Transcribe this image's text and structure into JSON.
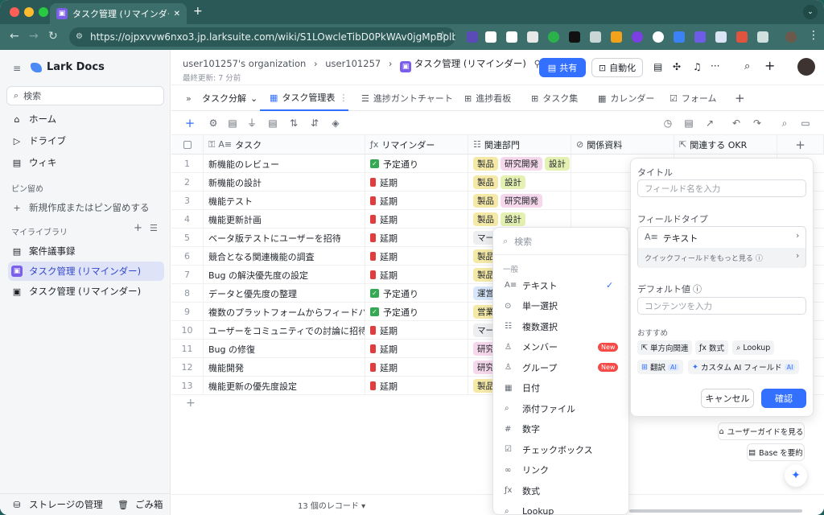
{
  "browser": {
    "tab_title": "タスク管理 (リマインダー) - Lar",
    "url": "https://ojpxvvw6nxo3.jp.larksuite.com/wiki/S1LOwcleTibD0PkWAv0jgMpBplb?table=tbl21..."
  },
  "sidebar": {
    "app_name": "Lark Docs",
    "search_label": "検索",
    "nav": [
      "ホーム",
      "ドライブ",
      "ウィキ"
    ],
    "pin_section": "ピン留め",
    "pin_new": "新規作成またはピン留めする",
    "library_section": "マイライブラリ",
    "library": [
      "案件議事録",
      "タスク管理 (リマインダー)",
      "タスク管理 (リマインダー)"
    ],
    "storage": "ストレージの管理",
    "trash": "ごみ箱"
  },
  "header": {
    "org": "user101257's organization",
    "user": "user101257",
    "title": "タスク管理 (リマインダー)",
    "updated": "最終更新: 7 分前",
    "share": "共有",
    "automation": "自動化"
  },
  "views": {
    "group": "タスク分解",
    "tabs": [
      "タスク管理表",
      "進捗ガントチャート",
      "進捗看板",
      "タスク集",
      "カレンダー",
      "フォーム"
    ]
  },
  "table": {
    "columns": [
      "タスク",
      "リマインダー",
      "関連部門",
      "関係資料",
      "関連する OKR"
    ],
    "rows": [
      {
        "n": "1",
        "task": "新機能のレビュー",
        "status": "予定通り",
        "ok": true,
        "depts": [
          "製品",
          "研究開発",
          "設計"
        ]
      },
      {
        "n": "2",
        "task": "新機能の設計",
        "status": "延期",
        "ok": false,
        "depts": [
          "製品",
          "設計"
        ]
      },
      {
        "n": "3",
        "task": "機能テスト",
        "status": "延期",
        "ok": false,
        "depts": [
          "製品",
          "研究開発"
        ]
      },
      {
        "n": "4",
        "task": "機能更新計画",
        "status": "延期",
        "ok": false,
        "depts": [
          "製品",
          "設計"
        ]
      },
      {
        "n": "5",
        "task": "ベータ版テストにユーザーを招待",
        "status": "延期",
        "ok": false,
        "depts": [
          "マー"
        ]
      },
      {
        "n": "6",
        "task": "競合となる関連機能の調査",
        "status": "延期",
        "ok": false,
        "depts": [
          "製品"
        ]
      },
      {
        "n": "7",
        "task": "Bug の解決優先度の設定",
        "status": "延期",
        "ok": false,
        "depts": [
          "製品"
        ]
      },
      {
        "n": "8",
        "task": "データと優先度の整理",
        "status": "予定通り",
        "ok": true,
        "depts": [
          "運営"
        ]
      },
      {
        "n": "9",
        "task": "複数のプラットフォームからフィードバ...",
        "status": "予定通り",
        "ok": true,
        "depts": [
          "営業"
        ]
      },
      {
        "n": "10",
        "task": "ユーザーをコミュニティでの討論に招待",
        "status": "延期",
        "ok": false,
        "depts": [
          "マー"
        ]
      },
      {
        "n": "11",
        "task": "Bug の修復",
        "status": "延期",
        "ok": false,
        "depts": [
          "研究"
        ]
      },
      {
        "n": "12",
        "task": "機能開発",
        "status": "延期",
        "ok": false,
        "depts": [
          "研究"
        ]
      },
      {
        "n": "13",
        "task": "機能更新の優先度設定",
        "status": "延期",
        "ok": false,
        "depts": [
          "製品"
        ]
      }
    ],
    "record_count": "13 個のレコード"
  },
  "field_type_menu": {
    "search_placeholder": "検索",
    "section": "一般",
    "items": [
      {
        "label": "テキスト",
        "icon": "A≡",
        "checked": true
      },
      {
        "label": "単一選択",
        "icon": "⊙"
      },
      {
        "label": "複数選択",
        "icon": "☷"
      },
      {
        "label": "メンバー",
        "icon": "♙",
        "badge": "New"
      },
      {
        "label": "グループ",
        "icon": "♙",
        "badge": "New"
      },
      {
        "label": "日付",
        "icon": "▦"
      },
      {
        "label": "添付ファイル",
        "icon": "⌕"
      },
      {
        "label": "数字",
        "icon": "#"
      },
      {
        "label": "チェックボックス",
        "icon": "☑"
      },
      {
        "label": "リンク",
        "icon": "∞"
      },
      {
        "label": "数式",
        "icon": "ƒx"
      },
      {
        "label": "Lookup",
        "icon": "⌕"
      }
    ]
  },
  "field_panel": {
    "title_label": "タイトル",
    "title_placeholder": "フィールド名を入力",
    "type_label": "フィールドタイプ",
    "type_value": "テキスト",
    "quick_more": "クイックフィールドをもっと見る",
    "default_label": "デフォルト値",
    "default_placeholder": "コンテンツを入力",
    "recommend": "おすすめ",
    "chips": [
      "単方向関連",
      "数式",
      "Lookup"
    ],
    "ai_chips": [
      "翻訳",
      "カスタム AI フィールド"
    ],
    "ai_badge": "AI",
    "cancel": "キャンセル",
    "confirm": "確認"
  },
  "floating": {
    "guide": "ユーザーガイドを見る",
    "summary": "Base を要約"
  },
  "colors": {
    "accent": "#3370ff",
    "chrome": "#3c6f6b",
    "tag_product": "#f5e9a8",
    "tag_rnd": "#f6d8ec",
    "tag_design": "#e4f1b3",
    "tag_ops": "#d8e7fb"
  }
}
